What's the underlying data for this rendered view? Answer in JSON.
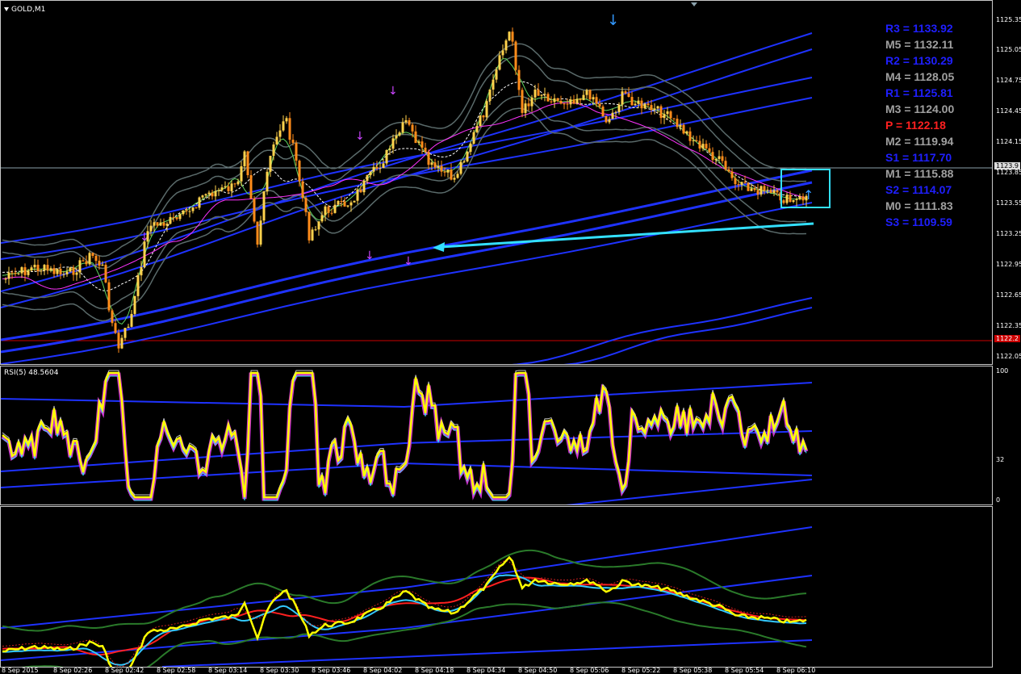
{
  "window": {
    "symbol_title": "GOLD,M1"
  },
  "rsi": {
    "title": "RSI(5) 48.5604",
    "levels": [
      "100",
      "32",
      "0"
    ]
  },
  "price_axis": [
    "1125.35",
    "1125.05",
    "1124.75",
    "1124.45",
    "1124.15",
    "1123.85",
    "1123.55",
    "1123.25",
    "1122.95",
    "1122.65",
    "1122.35",
    "1122.05"
  ],
  "current_price_label": "1123.9",
  "red_line_label": "1122.2",
  "pivots": [
    {
      "label": "R3 = 1133.92",
      "color": "#1f1fff"
    },
    {
      "label": "M5 = 1132.11",
      "color": "#a0a0a0"
    },
    {
      "label": "R2 = 1130.29",
      "color": "#1f1fff"
    },
    {
      "label": "M4 = 1128.05",
      "color": "#a0a0a0"
    },
    {
      "label": "R1 = 1125.81",
      "color": "#1f1fff"
    },
    {
      "label": "M3 = 1124.00",
      "color": "#a0a0a0"
    },
    {
      "label": "P   = 1122.18",
      "color": "#ff2020"
    },
    {
      "label": "M2 = 1119.94",
      "color": "#a0a0a0"
    },
    {
      "label": "S1 = 1117.70",
      "color": "#1f1fff"
    },
    {
      "label": "M1 = 1115.88",
      "color": "#a0a0a0"
    },
    {
      "label": "S2 = 1114.07",
      "color": "#1f1fff"
    },
    {
      "label": "M0 = 1111.83",
      "color": "#a0a0a0"
    },
    {
      "label": "S3 = 1109.59",
      "color": "#1f1fff"
    }
  ],
  "time_axis": [
    "8 Sep 2015",
    "8 Sep 02:26",
    "8 Sep 02:42",
    "8 Sep 02:58",
    "8 Sep 03:14",
    "8 Sep 03:30",
    "8 Sep 03:46",
    "8 Sep 04:02",
    "8 Sep 04:18",
    "8 Sep 04:34",
    "8 Sep 04:50",
    "8 Sep 05:06",
    "8 Sep 05:22",
    "8 Sep 05:38",
    "8 Sep 05:54",
    "8 Sep 06:10"
  ],
  "colors": {
    "up_candle": "#ff8c1a",
    "down_candle": "#ffd24d",
    "band_blue": "#1e32ff",
    "band_gray": "#5a6a6a",
    "cyan": "#33e0ff",
    "yellow": "#ffff00",
    "magenta": "#ff33ff"
  }
}
